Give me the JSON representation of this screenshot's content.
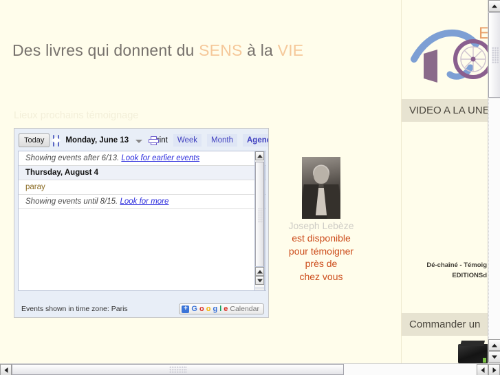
{
  "page": {
    "background_color": "#fffdeb",
    "tagline": {
      "part1": "Des livres qui donnent du ",
      "highlight1": "SENS",
      "part2": " à la ",
      "highlight2": "VIE",
      "highlight_color": "#f5c89a",
      "text_color": "#77726d"
    },
    "section_heading": "Lieux prochains témoignage"
  },
  "calendar": {
    "toolbar": {
      "today_label": "Today",
      "prev_icon": "chevron-left-icon",
      "next_icon": "chevron-right-icon",
      "current_date": "Monday, June 13",
      "dropdown_icon": "caret-down-icon",
      "print_icon": "printer-icon",
      "print_label": "Print",
      "views": [
        {
          "label": "Week",
          "active": false
        },
        {
          "label": "Month",
          "active": false
        },
        {
          "label": "Agenda",
          "active": true
        }
      ]
    },
    "agenda_rows": [
      {
        "type": "note",
        "text": "Showing events after 6/13. ",
        "link": "Look for earlier events"
      },
      {
        "type": "day",
        "text": "Thursday, August 4"
      },
      {
        "type": "event",
        "text": "paray"
      },
      {
        "type": "note",
        "text": "Showing events until 8/15. ",
        "link": "Look for more"
      }
    ],
    "footer": {
      "timezone_text": "Events shown in time zone: Paris",
      "badge": {
        "plus": "+",
        "g1": "G",
        "g2": "o",
        "g3": "o",
        "g4": "g",
        "g5": "l",
        "g6": "e",
        "calendar": "Calendar"
      }
    },
    "scrollbar": {
      "up_icon": "scroll-up-arrow-icon",
      "down_icon": "scroll-down-arrow-icon"
    }
  },
  "promo": {
    "photo_alt": "joseph-lebeze-portrait",
    "name": "Joseph Lebèze",
    "name_color": "#cfcdc6",
    "lines": [
      "est disponible",
      "pour témoigner",
      "près de",
      "chez vous"
    ],
    "lines_color": "#cc4c1b"
  },
  "sidebar": {
    "logo_alt": "publisher-logo",
    "logo_letter": "E",
    "panels": [
      {
        "title": "VIDEO A LA UNE"
      },
      {
        "title": "Commander un"
      }
    ],
    "book_caption_line1": "Dé-chaîné - Témoig",
    "book_caption_line2": "EDITIONSd",
    "book_thumb_alt": "book-cover-thumbnail"
  },
  "scrollbars": {
    "vertical": {
      "up_icon": "scroll-up-arrow-icon",
      "down_icon": "scroll-down-arrow-icon"
    },
    "horizontal": {
      "left_icon": "scroll-left-arrow-icon",
      "right_icon": "scroll-right-arrow-icon"
    }
  }
}
